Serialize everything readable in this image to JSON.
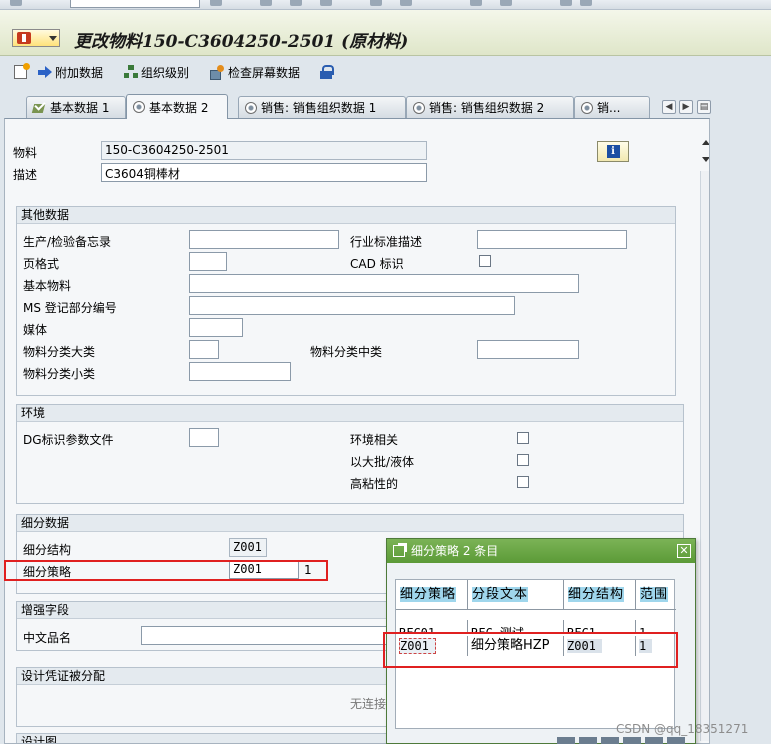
{
  "window": {
    "title": "更改物料150-C3604250-2501 (原材料)"
  },
  "toolbar": {
    "additional_data": "附加数据",
    "org_levels": "组织级别",
    "check_screen_data": "检查屏幕数据"
  },
  "tabs": [
    {
      "label": "基本数据 1",
      "icon": "check-icon"
    },
    {
      "label": "基本数据 2",
      "icon": "radio-icon"
    },
    {
      "label": "销售: 销售组织数据 1",
      "icon": "radio-icon"
    },
    {
      "label": "销售: 销售组织数据 2",
      "icon": "radio-icon"
    },
    {
      "label": "销...",
      "icon": "radio-icon"
    }
  ],
  "header": {
    "material_label": "物料",
    "material_value": "150-C3604250-2501",
    "desc_label": "描述",
    "desc_value": "C3604铜棒材"
  },
  "other_data": {
    "title": "其他数据",
    "lab_office": "生产/检验备忘录",
    "industry_desc": "行业标准描述",
    "page_format": "页格式",
    "cad_indicator": "CAD 标识",
    "basic_material": "基本物料",
    "ms_book_part": "MS 登记部分编号",
    "medium": "媒体",
    "cat_major": "物料分类大类",
    "cat_middle": "物料分类中类",
    "cat_minor": "物料分类小类"
  },
  "environment": {
    "title": "环境",
    "dg_profile": "DG标识参数文件",
    "env_relevant": "环境相关",
    "bulk_liquid": "以大批/液体",
    "high_viscosity": "高粘性的"
  },
  "segmentation": {
    "title": "细分数据",
    "structure_label": "细分结构",
    "structure_value": "Z001",
    "strategy_label": "细分策略",
    "strategy_value": "Z001",
    "strategy_suffix": "1"
  },
  "enhancement": {
    "title": "增强字段",
    "cn_name": "中文品名"
  },
  "design_doc": {
    "title": "设计凭证被分配",
    "no_link": "无连接"
  },
  "design_drawing": {
    "title": "设计图"
  },
  "popup": {
    "title": "细分策略 2 条目",
    "columns": [
      "细分策略",
      "分段文本",
      "细分结构",
      "范围"
    ],
    "rows": [
      [
        "RFC01",
        "RFC 测试",
        "RFC1",
        "1"
      ],
      [
        "Z001",
        "细分策略HZP",
        "Z001",
        "1"
      ]
    ]
  },
  "watermark": "CSDN @qq_18351271"
}
